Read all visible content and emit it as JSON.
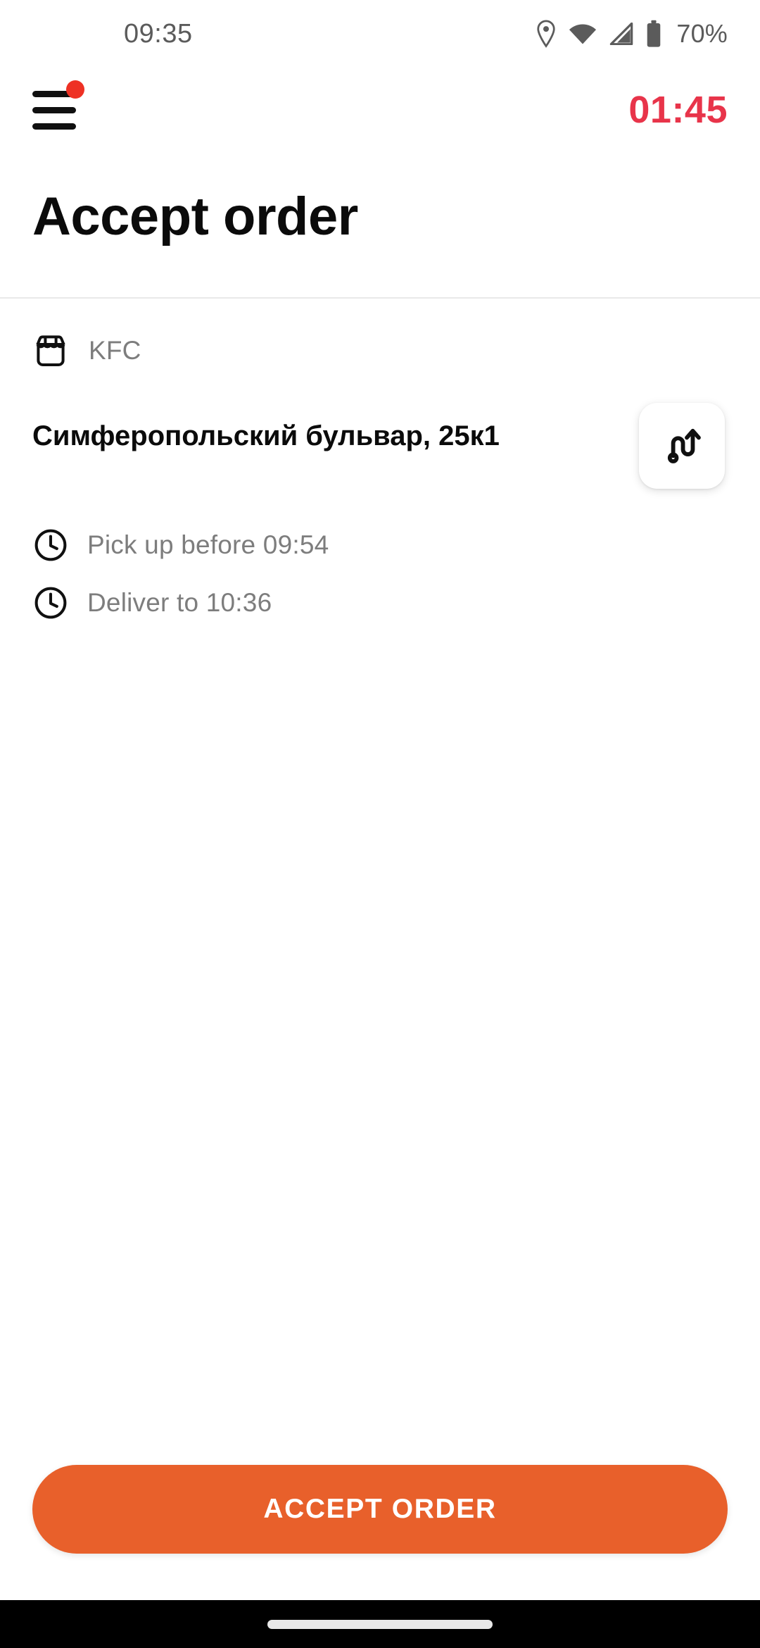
{
  "status_bar": {
    "time": "09:35",
    "battery_percent": "70%",
    "icons": [
      "location-pin-icon",
      "wifi-icon",
      "cellular-signal-icon",
      "battery-icon"
    ]
  },
  "app_bar": {
    "menu_icon": "hamburger-menu-icon",
    "has_notification_dot": true,
    "timer": "01:45",
    "timer_color": "#E8344A"
  },
  "page": {
    "title": "Accept order"
  },
  "order": {
    "venue_icon": "storefront-icon",
    "venue_name": "KFC",
    "address": "Симферопольский бульвар, 25к1",
    "route_icon": "route-arrow-icon",
    "times": [
      {
        "icon": "clock-icon",
        "label": "Pick up before 09:54"
      },
      {
        "icon": "clock-icon",
        "label": "Deliver to 10:36"
      }
    ]
  },
  "cta": {
    "accept_label": "ACCEPT ORDER",
    "accept_color": "#E8602B"
  },
  "nav_bar": {
    "gesture_pill": "home-gesture-pill"
  }
}
